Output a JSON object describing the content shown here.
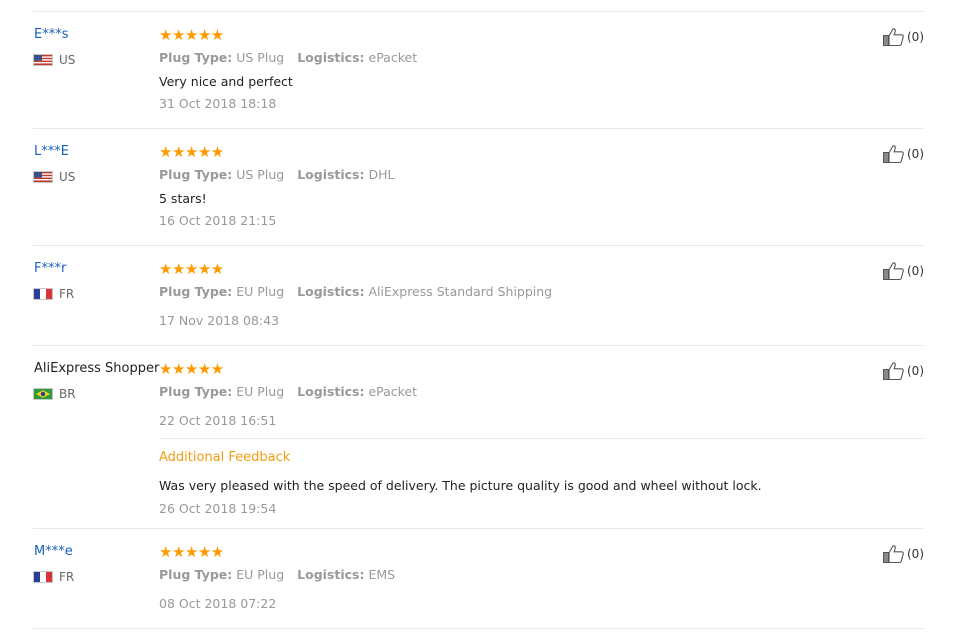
{
  "helpful_count_label": "(0)",
  "colors": {
    "star": "#ff9a00",
    "username_link": "#1a60b8",
    "additional_feedback": "#f39c12",
    "muted": "#999999"
  },
  "reviews": [
    {
      "user": "E***s",
      "country": "US",
      "flag": "us-flag-icon",
      "stars": "★★★★★",
      "rating": 5,
      "plug_label": "Plug Type:",
      "plug_value": "US Plug",
      "logistics_label": "Logistics:",
      "logistics_value": "ePacket",
      "text": "Very nice and perfect",
      "date": "31 Oct 2018 18:18",
      "helpful": "(0)"
    },
    {
      "user": "L***E",
      "country": "US",
      "flag": "us-flag-icon",
      "stars": "★★★★★",
      "rating": 5,
      "plug_label": "Plug Type:",
      "plug_value": "US Plug",
      "logistics_label": "Logistics:",
      "logistics_value": "DHL",
      "text": "5 stars!",
      "date": "16 Oct 2018 21:15",
      "helpful": "(0)"
    },
    {
      "user": "F***r",
      "country": "FR",
      "flag": "fr-flag-icon",
      "stars": "★★★★★",
      "rating": 5,
      "plug_label": "Plug Type:",
      "plug_value": "EU Plug",
      "logistics_label": "Logistics:",
      "logistics_value": "AliExpress Standard Shipping",
      "text": "",
      "date": "17 Nov 2018 08:43",
      "helpful": "(0)"
    },
    {
      "user": "AliExpress Shopper",
      "country": "BR",
      "flag": "br-flag-icon",
      "stars": "★★★★★",
      "rating": 5,
      "plug_label": "Plug Type:",
      "plug_value": "EU Plug",
      "logistics_label": "Logistics:",
      "logistics_value": "ePacket",
      "text": "",
      "date": "22 Oct 2018 16:51",
      "helpful": "(0)",
      "additional": {
        "title": "Additional Feedback",
        "text": "Was very pleased with the speed of delivery. The picture quality is good and wheel without lock.",
        "date": "26 Oct 2018 19:54"
      }
    },
    {
      "user": "M***e",
      "country": "FR",
      "flag": "fr-flag-icon",
      "stars": "★★★★★",
      "rating": 5,
      "plug_label": "Plug Type:",
      "plug_value": "EU Plug",
      "logistics_label": "Logistics:",
      "logistics_value": "EMS",
      "text": "",
      "date": "08 Oct 2018 07:22",
      "helpful": "(0)"
    }
  ]
}
